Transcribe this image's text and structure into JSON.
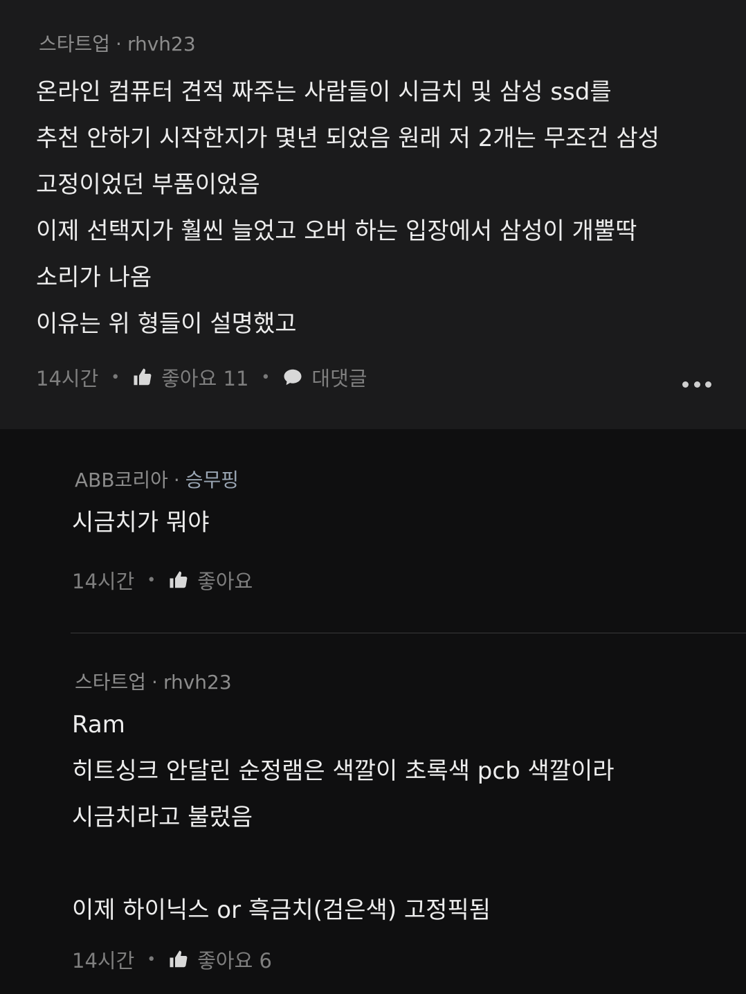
{
  "comment": {
    "author_org": "스타트업",
    "author_name": "rhvh23",
    "body": "온라인 컴퓨터 견적 짜주는 사람들이 시금치 및 삼성 ssd를\n추천 안하기 시작한지가 몇년 되었음 원래 저 2개는 무조건 삼성\n고정이었던 부품이었음\n이제 선택지가 훨씬 늘었고 오버 하는 입장에서 삼성이 개뿔딱\n소리가 나옴\n이유는 위 형들이 설명했고",
    "time": "14시간",
    "like_label": "좋아요 11",
    "reply_label": "대댓글"
  },
  "replies": [
    {
      "author_org": "ABB코리아",
      "author_name": "승무핑",
      "body": "시금치가 뭐야",
      "time": "14시간",
      "like_label": "좋아요"
    },
    {
      "author_org": "스타트업",
      "author_name": "rhvh23",
      "body": "Ram\n히트싱크 안달린 순정램은 색깔이 초록색 pcb 색깔이라\n시금치라고 불렀음\n\n이제 하이닉스 or  흑금치(검은색) 고정픽됨",
      "time": "14시간",
      "like_label": "좋아요 6"
    }
  ],
  "colors": {
    "background": "#0f0f10",
    "comment_background": "#1b1b1c",
    "text": "#ededed",
    "meta": "#7f7f7f",
    "author_name_highlight": "#9aa6b4"
  }
}
